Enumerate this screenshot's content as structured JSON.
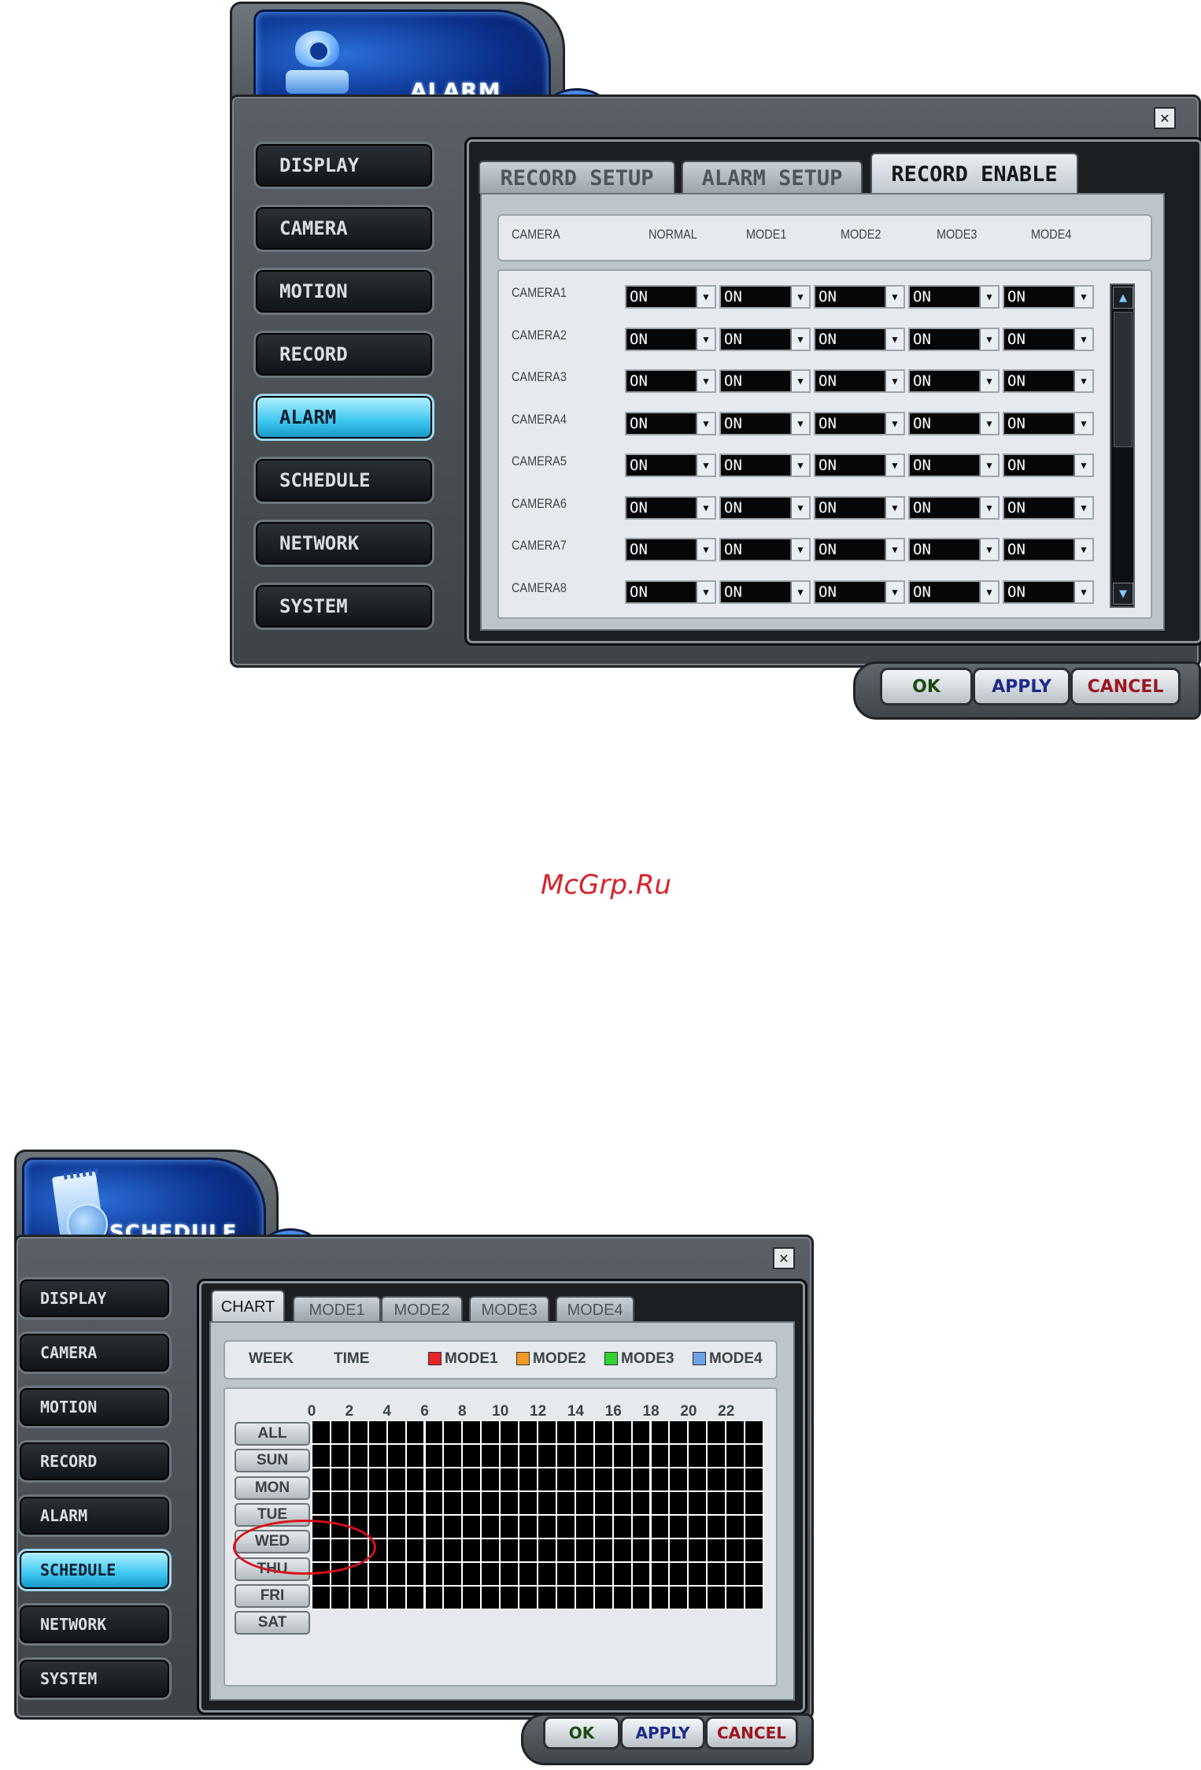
{
  "alarm_window": {
    "title": "ALARM",
    "close_glyph": "✕",
    "sidebar": [
      {
        "label": "DISPLAY",
        "active": false
      },
      {
        "label": "CAMERA",
        "active": false
      },
      {
        "label": "MOTION",
        "active": false
      },
      {
        "label": "RECORD",
        "active": false
      },
      {
        "label": "ALARM",
        "active": true
      },
      {
        "label": "SCHEDULE",
        "active": false
      },
      {
        "label": "NETWORK",
        "active": false
      },
      {
        "label": "SYSTEM",
        "active": false
      }
    ],
    "tabs": [
      {
        "label": "RECORD SETUP",
        "active": false
      },
      {
        "label": "ALARM SETUP",
        "active": false
      },
      {
        "label": "RECORD ENABLE",
        "active": true
      }
    ],
    "columns": [
      "CAMERA",
      "NORMAL",
      "MODE1",
      "MODE2",
      "MODE3",
      "MODE4"
    ],
    "rows": [
      {
        "camera": "CAMERA1",
        "values": [
          "ON",
          "ON",
          "ON",
          "ON",
          "ON"
        ]
      },
      {
        "camera": "CAMERA2",
        "values": [
          "ON",
          "ON",
          "ON",
          "ON",
          "ON"
        ]
      },
      {
        "camera": "CAMERA3",
        "values": [
          "ON",
          "ON",
          "ON",
          "ON",
          "ON"
        ]
      },
      {
        "camera": "CAMERA4",
        "values": [
          "ON",
          "ON",
          "ON",
          "ON",
          "ON"
        ]
      },
      {
        "camera": "CAMERA5",
        "values": [
          "ON",
          "ON",
          "ON",
          "ON",
          "ON"
        ]
      },
      {
        "camera": "CAMERA6",
        "values": [
          "ON",
          "ON",
          "ON",
          "ON",
          "ON"
        ]
      },
      {
        "camera": "CAMERA7",
        "values": [
          "ON",
          "ON",
          "ON",
          "ON",
          "ON"
        ]
      },
      {
        "camera": "CAMERA8",
        "values": [
          "ON",
          "ON",
          "ON",
          "ON",
          "ON"
        ]
      }
    ],
    "buttons": {
      "ok": "OK",
      "apply": "APPLY",
      "cancel": "CANCEL"
    }
  },
  "watermark": "McGrp.Ru",
  "schedule_window": {
    "title": "SCHEDULE",
    "close_glyph": "✕",
    "sidebar": [
      {
        "label": "DISPLAY",
        "active": false
      },
      {
        "label": "CAMERA",
        "active": false
      },
      {
        "label": "MOTION",
        "active": false
      },
      {
        "label": "RECORD",
        "active": false
      },
      {
        "label": "ALARM",
        "active": false
      },
      {
        "label": "SCHEDULE",
        "active": true
      },
      {
        "label": "NETWORK",
        "active": false
      },
      {
        "label": "SYSTEM",
        "active": false
      }
    ],
    "tabs": [
      {
        "label": "CHART",
        "active": true
      },
      {
        "label": "MODE1",
        "active": false
      },
      {
        "label": "MODE2",
        "active": false
      },
      {
        "label": "MODE3",
        "active": false
      },
      {
        "label": "MODE4",
        "active": false
      }
    ],
    "header": {
      "week": "WEEK",
      "time": "TIME"
    },
    "legend": [
      {
        "label": "MODE1",
        "color": "#e8232a"
      },
      {
        "label": "MODE2",
        "color": "#f39a22"
      },
      {
        "label": "MODE3",
        "color": "#2fd42f"
      },
      {
        "label": "MODE4",
        "color": "#6fa3e8"
      }
    ],
    "hours": [
      "0",
      "2",
      "4",
      "6",
      "8",
      "10",
      "12",
      "14",
      "16",
      "18",
      "20",
      "22"
    ],
    "days": [
      "ALL",
      "SUN",
      "MON",
      "TUE",
      "WED",
      "THU",
      "FRI",
      "SAT"
    ],
    "buttons": {
      "ok": "OK",
      "apply": "APPLY",
      "cancel": "CANCEL"
    },
    "highlight_color": "#d8101a"
  }
}
